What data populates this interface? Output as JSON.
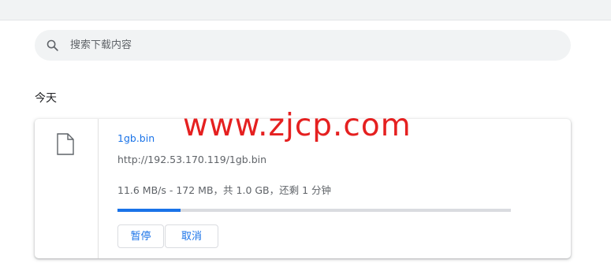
{
  "search": {
    "placeholder": "搜索下载内容"
  },
  "section": {
    "title": "今天"
  },
  "download": {
    "file_name": "1gb.bin",
    "url": "http://192.53.170.119/1gb.bin",
    "status": "11.6 MB/s - 172 MB，共 1.0 GB，还剩 1 分钟",
    "progress_fraction": 0.16,
    "pause_label": "暂停",
    "cancel_label": "取消"
  },
  "watermark": {
    "text": "www.zjcp.com"
  },
  "colors": {
    "accent": "#1a73e8",
    "watermark": "#e52020"
  }
}
